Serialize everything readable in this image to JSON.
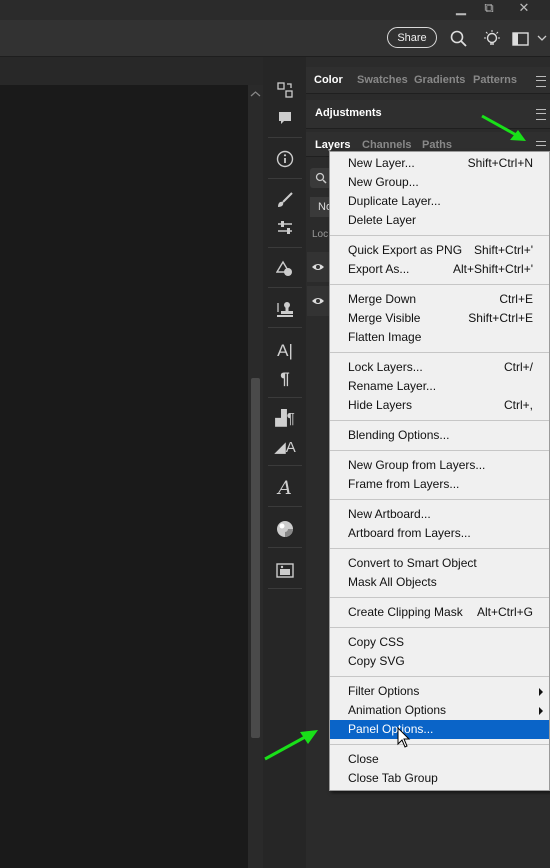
{
  "window": {
    "minimize": "▁",
    "restore": "⧉",
    "close": "✕"
  },
  "optionsbar": {
    "share_label": "Share",
    "icons": [
      "search-icon",
      "bulb-icon",
      "workspace-icon",
      "chevron-down-icon"
    ]
  },
  "collapse": {
    "left": "«",
    "right": "»"
  },
  "tools": [
    "history-icon",
    "comment-icon",
    "info-icon",
    "brush-icon",
    "adjust-icon",
    "shape-icon",
    "stamp-icon",
    "character-icon",
    "paragraph-icon",
    "paragraph-style-icon",
    "character-style-icon",
    "glyph-icon",
    "material-icon",
    "image-icon"
  ],
  "panel_tabs_row1": [
    "Color",
    "Swatches",
    "Gradients",
    "Patterns"
  ],
  "panel_tabs_row2": [
    "Adjustments"
  ],
  "panel_tabs_row3": [
    "Layers",
    "Channels",
    "Paths"
  ],
  "layers_stub": {
    "mode": "No",
    "lock": "Loc"
  },
  "accent_color": "#0a64c8",
  "menu": {
    "groups": [
      [
        {
          "label": "New Layer...",
          "shortcut": "Shift+Ctrl+N"
        },
        {
          "label": "New Group...",
          "shortcut": ""
        },
        {
          "label": "Duplicate Layer...",
          "shortcut": ""
        },
        {
          "label": "Delete Layer",
          "shortcut": ""
        }
      ],
      [
        {
          "label": "Quick Export as PNG",
          "shortcut": "Shift+Ctrl+'"
        },
        {
          "label": "Export As...",
          "shortcut": "Alt+Shift+Ctrl+'"
        }
      ],
      [
        {
          "label": "Merge Down",
          "shortcut": "Ctrl+E"
        },
        {
          "label": "Merge Visible",
          "shortcut": "Shift+Ctrl+E"
        },
        {
          "label": "Flatten Image",
          "shortcut": ""
        }
      ],
      [
        {
          "label": "Lock Layers...",
          "shortcut": "Ctrl+/"
        },
        {
          "label": "Rename Layer...",
          "shortcut": ""
        },
        {
          "label": "Hide Layers",
          "shortcut": "Ctrl+,"
        }
      ],
      [
        {
          "label": "Blending Options...",
          "shortcut": ""
        }
      ],
      [
        {
          "label": "New Group from Layers...",
          "shortcut": ""
        },
        {
          "label": "Frame from Layers...",
          "shortcut": ""
        }
      ],
      [
        {
          "label": "New Artboard...",
          "shortcut": ""
        },
        {
          "label": "Artboard from Layers...",
          "shortcut": ""
        }
      ],
      [
        {
          "label": "Convert to Smart Object",
          "shortcut": ""
        },
        {
          "label": "Mask All Objects",
          "shortcut": ""
        }
      ],
      [
        {
          "label": "Create Clipping Mask",
          "shortcut": "Alt+Ctrl+G"
        }
      ],
      [
        {
          "label": "Copy CSS",
          "shortcut": ""
        },
        {
          "label": "Copy SVG",
          "shortcut": ""
        }
      ],
      [
        {
          "label": "Filter Options",
          "shortcut": "",
          "submenu": true
        },
        {
          "label": "Animation Options",
          "shortcut": "",
          "submenu": true
        },
        {
          "label": "Panel Options...",
          "shortcut": "",
          "highlighted": true
        }
      ],
      [
        {
          "label": "Close",
          "shortcut": ""
        },
        {
          "label": "Close Tab Group",
          "shortcut": ""
        }
      ]
    ]
  }
}
